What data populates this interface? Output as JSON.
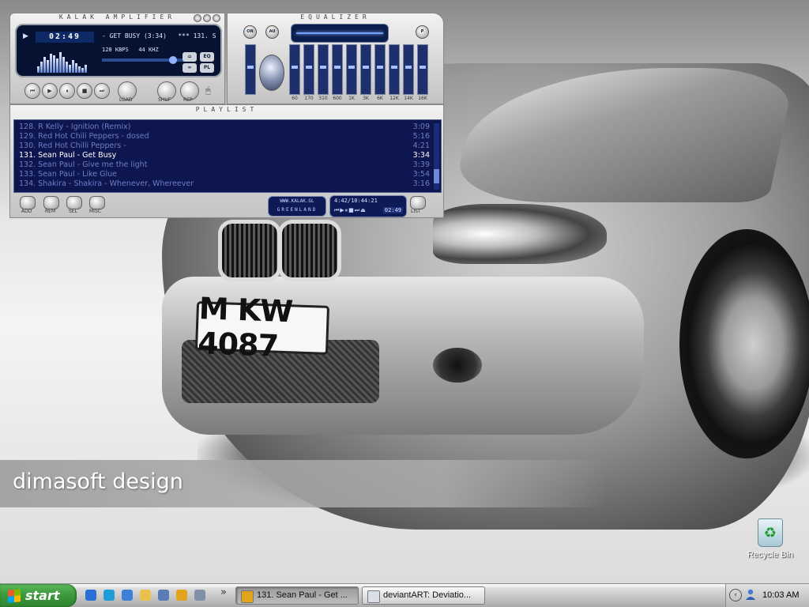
{
  "desktop": {
    "wallpaper": {
      "brand_text": "dimasoft design",
      "plate_text": "M KW 4087"
    },
    "icons": [
      {
        "label": "Recycle Bin",
        "icon": "recycle-bin-icon"
      }
    ]
  },
  "player": {
    "amp": {
      "title": "KALAK AMPLIFIER",
      "time": "02:49",
      "song": "- GET BUSY (3:34)",
      "track_no": "*** 131. S",
      "bitrate": "128 KBPS",
      "samplerate": "44 KHZ",
      "eq_label": "EQ",
      "pl_label": "PL",
      "buttons": {
        "load": "LOAD",
        "shuffle": "SHUF",
        "repeat": "REP"
      },
      "progress_fraction": 0.79
    },
    "eq": {
      "title": "EQUALIZER",
      "on_label": "ON",
      "auto_label": "AU",
      "presets_label": "P",
      "bands": [
        "60",
        "170",
        "310",
        "600",
        "1K",
        "3K",
        "6K",
        "12K",
        "14K",
        "16K"
      ]
    },
    "playlist": {
      "title": "PLAYLIST",
      "current_index": 3,
      "tracks": [
        {
          "title": "128. R Kelly - Ignition (Remix)",
          "duration": "3:09"
        },
        {
          "title": "129. Red Hot Chili Peppers - dosed",
          "duration": "5:16"
        },
        {
          "title": "130. Red Hot Chilli Peppers -",
          "duration": "4:21"
        },
        {
          "title": "131. Sean Paul - Get Busy",
          "duration": "3:34"
        },
        {
          "title": "132. Sean Paul - Give me the light",
          "duration": "3:39"
        },
        {
          "title": "133. Sean Paul - Like Glue",
          "duration": "3:54"
        },
        {
          "title": "134. Shakira - Shakira - Whenever, Whereever",
          "duration": "3:16"
        }
      ],
      "buttons": {
        "add": "ADD",
        "rem": "REM",
        "sel": "SEL",
        "misc": "MISC",
        "list": "LIST"
      },
      "logo_url": "WWW.KALAK.GL",
      "logo_name": "GREENLAND",
      "total_time": "4:42/10:44:21",
      "elapsed": "02:49"
    }
  },
  "taskbar": {
    "start_label": "start",
    "quick_launch": [
      {
        "name": "ql-ie-icon",
        "color": "#2a6fd6"
      },
      {
        "name": "ql-explorer-icon",
        "color": "#1f9bd8"
      },
      {
        "name": "ql-media-icon",
        "color": "#3f7fd8"
      },
      {
        "name": "ql-folder-icon",
        "color": "#e9c04c"
      },
      {
        "name": "ql-network-icon",
        "color": "#5b7bb8"
      },
      {
        "name": "ql-winamp-icon",
        "color": "#e1a41b"
      },
      {
        "name": "ql-app-icon",
        "color": "#8090a8"
      }
    ],
    "tasks": [
      {
        "label": "131. Sean Paul - Get ...",
        "active": true,
        "icon": "winamp-icon"
      },
      {
        "label": "deviantART: Deviatio...",
        "active": false,
        "icon": "browser-icon"
      }
    ],
    "clock": "10:03 AM"
  }
}
